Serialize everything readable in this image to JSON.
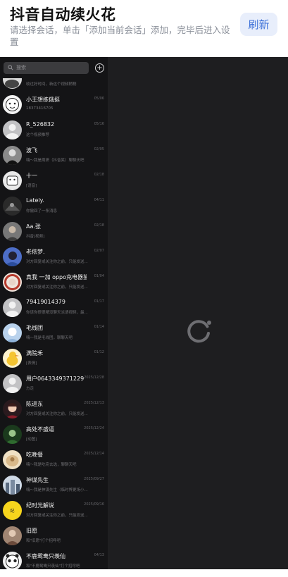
{
  "header": {
    "title": "抖音自动续火花",
    "subtitle": "请选择会话，单击「添加当前会话」添加，完毕后进入设置",
    "refresh_label": "刷新"
  },
  "app": {
    "search_placeholder": "搜索",
    "add_icon": "plus-circle-icon",
    "top_partial_message": "收过好时间，新这个视频稍稍",
    "conversations": [
      {
        "name": "小王想练俄挺",
        "time": "05/06",
        "message": "18373416705",
        "avatar": "cartoon-face-white"
      },
      {
        "name": "R_526832",
        "time": "05/16",
        "message": "这个视频推荐",
        "avatar": "default-gray"
      },
      {
        "name": "波飞",
        "time": "02/05",
        "message": "嗨～我是周妍（抖音笑）聊聊天吧",
        "avatar": "photo-bw"
      },
      {
        "name": "十一",
        "time": "02/18",
        "message": "[语音]",
        "avatar": "cartoon-white"
      },
      {
        "name": "Lately.",
        "time": "04/11",
        "message": "你撤回了一条消息",
        "avatar": "photo-dark"
      },
      {
        "name": "Aa.张",
        "time": "02/18",
        "message": "抖音[视频]",
        "avatar": "photo-gray"
      },
      {
        "name": "老侬梦.",
        "time": "02/07",
        "message": "对方回复或关注你之前，只能发送...",
        "avatar": "photo-blue"
      },
      {
        "name": "真我 一加 oppo充电器鉴...",
        "time": "01/04",
        "message": "对方回复或关注你之前，只能发送...",
        "avatar": "logo-red"
      },
      {
        "name": "79419014379",
        "time": "01/17",
        "message": "你该你很很精没聊天派请视频，最...",
        "avatar": "default-gray"
      },
      {
        "name": "毛线团",
        "time": "01/14",
        "message": "嗨～我是毛线团，聊聊天吧",
        "avatar": "photo-lightblue"
      },
      {
        "name": "满院禾",
        "time": "01/12",
        "message": "[表情]",
        "avatar": "duck-yellow"
      },
      {
        "name": "用户0643349371229",
        "time": "2025/12/28",
        "message": "方走",
        "avatar": "default-gray"
      },
      {
        "name": "陈进东",
        "time": "2025/12/13",
        "message": "对方回复或关注你之前，只能发送...",
        "avatar": "photo-anime"
      },
      {
        "name": "高处不盛逼",
        "time": "2025/12/24",
        "message": "[动图]",
        "avatar": "photo-green"
      },
      {
        "name": "吃晚餐",
        "time": "2025/12/14",
        "message": "嗨～我是吃完去选，聊聊天吧",
        "avatar": "photo-beige"
      },
      {
        "name": "神谋先生",
        "time": "2025/09/27",
        "message": "嗨～我是神谋先生（临时弊更场小...",
        "avatar": "photo-city"
      },
      {
        "name": "纪时光解说",
        "time": "2025/09/16",
        "message": "对方回复或关注你之前，只能发送...",
        "avatar": "logo-yellow"
      },
      {
        "name": "旧愿",
        "time": "",
        "message": "和\"旧愿\"打个招呼吧",
        "avatar": "photo-person"
      },
      {
        "name": "不鹿鸳鸯只羡仙",
        "time": "04/13",
        "message": "和\"不鹿鸳鸯只羡仙\"打个招呼吧",
        "avatar": "cartoon-panda"
      }
    ],
    "loading_icon": "loading-spinner-icon"
  },
  "colors": {
    "accent": "#3a6fd8",
    "panel_bg": "#141416",
    "content_bg": "#1e1e20"
  }
}
